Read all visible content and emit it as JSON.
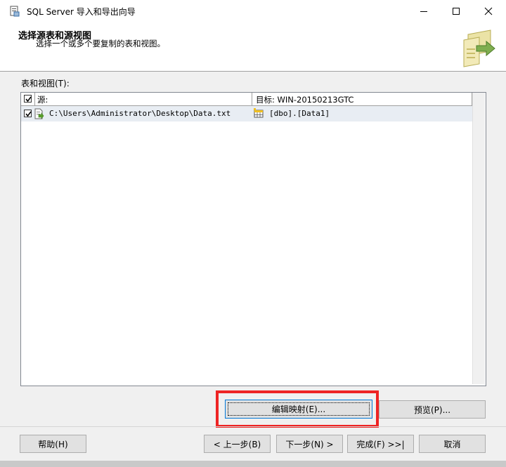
{
  "window": {
    "title": "SQL Server 导入和导出向导",
    "controls": [
      "minimize",
      "maximize",
      "close"
    ]
  },
  "header": {
    "title": "选择源表和源视图",
    "subtitle": "选择一个或多个要复制的表和视图。"
  },
  "section": {
    "label": "表和视图(T):"
  },
  "grid": {
    "columns": {
      "source": "源:",
      "destination": "目标: WIN-20150213GTC"
    },
    "header_checked": true,
    "rows": [
      {
        "checked": true,
        "source": "C:\\Users\\Administrator\\Desktop\\Data.txt",
        "destination": "[dbo].[Data1]"
      }
    ]
  },
  "buttons": {
    "edit_mappings": "编辑映射(E)...",
    "preview": "预览(P)...",
    "help": "帮助(H)",
    "back": "< 上一步(B)",
    "next": "下一步(N) >",
    "finish": "完成(F) >>|",
    "cancel": "取消"
  },
  "colors": {
    "highlight": "#ee2424",
    "row_selected": "#e8edf3",
    "focus_border": "#0078d7"
  }
}
